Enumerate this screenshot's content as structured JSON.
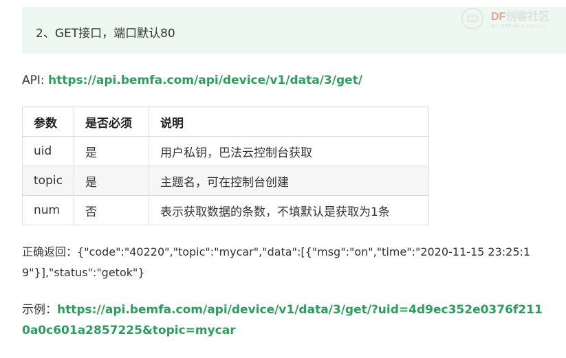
{
  "heading": {
    "text": "2、GET接口，端口默认80"
  },
  "watermark": {
    "brand": "DF",
    "brand_rest": "创客社区",
    "subtitle": "mc.DFRobot.com.cn"
  },
  "api": {
    "label": "API: ",
    "url": "https://api.bemfa.com/api/device/v1/data/3/get/"
  },
  "table": {
    "headers": [
      "参数",
      "是否必须",
      "说明"
    ],
    "rows": [
      [
        "uid",
        "是",
        "用户私钥，巴法云控制台获取"
      ],
      [
        "topic",
        "是",
        "主题名，可在控制台创建"
      ],
      [
        "num",
        "否",
        "表示获取数据的条数，不填默认是获取为1条"
      ]
    ]
  },
  "return": {
    "label": "正确返回：",
    "body": "{\"code\":\"40220\",\"topic\":\"mycar\",\"data\":[{\"msg\":\"on\",\"time\":\"2020-11-15 23:25:19\"}],\"status\":\"getok\"}"
  },
  "example": {
    "label": "示例：",
    "url": "https://api.bemfa.com/api/device/v1/data/3/get/?uid=4d9ec352e0376f2110a0c601a2857225&topic=mycar"
  },
  "colors": {
    "link": "#2c9e5b",
    "heading_bg": "#eef8f2"
  }
}
